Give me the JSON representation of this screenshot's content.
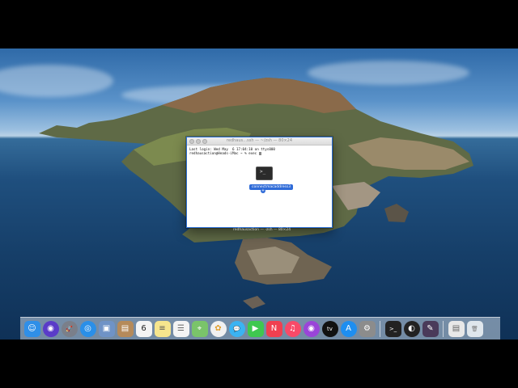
{
  "terminal": {
    "title": "redhaus…ssh — ~/zsh — 80×24",
    "lines": [
      "Last login: Wed May  6 17:04:10 on ttys000",
      "redhausaction@Heads-iMac ~ % exec "
    ]
  },
  "drag": {
    "icon_symbol": ">_",
    "label": "connectmacaddress3",
    "plus": "+"
  },
  "window_shadow_title": "redhausaction — -zsh — 80×24",
  "dock": {
    "items": [
      {
        "name": "finder-icon",
        "symbol": "☺",
        "bg": "#2f8fe8"
      },
      {
        "name": "siri-icon",
        "symbol": "◉",
        "bg": "#5a3cc8"
      },
      {
        "name": "launchpad-icon",
        "symbol": "🚀",
        "bg": "#7a7f8a"
      },
      {
        "name": "safari-icon",
        "symbol": "◎",
        "bg": "#2a8fe8"
      },
      {
        "name": "preview-icon",
        "symbol": "▣",
        "bg": "#6f93c6"
      },
      {
        "name": "contacts-icon",
        "symbol": "▤",
        "bg": "#b58a5a"
      },
      {
        "name": "calendar-icon",
        "symbol": "6",
        "bg": "#f4f4f4",
        "fg": "#222"
      },
      {
        "name": "notes-icon",
        "symbol": "≡",
        "bg": "#f6e58d",
        "fg": "#555"
      },
      {
        "name": "reminders-icon",
        "symbol": "☰",
        "bg": "#f4f4f4",
        "fg": "#666"
      },
      {
        "name": "maps-icon",
        "symbol": "⌖",
        "bg": "#7ac46a"
      },
      {
        "name": "photos-icon",
        "symbol": "✿",
        "bg": "#f1f1f1",
        "fg": "#e0a030"
      },
      {
        "name": "messages-icon",
        "symbol": "💬",
        "bg": "#3bb3f2"
      },
      {
        "name": "facetime-icon",
        "symbol": "▶",
        "bg": "#3fc84f"
      },
      {
        "name": "news-icon",
        "symbol": "N",
        "bg": "#f04050"
      },
      {
        "name": "music-icon",
        "symbol": "♫",
        "bg": "#f84a68"
      },
      {
        "name": "podcasts-icon",
        "symbol": "◉",
        "bg": "#9a45d8"
      },
      {
        "name": "apple-tv-icon",
        "symbol": "tv",
        "bg": "#111"
      },
      {
        "name": "app-store-icon",
        "symbol": "A",
        "bg": "#1e8ef0"
      },
      {
        "name": "system-preferences-icon",
        "symbol": "⚙",
        "bg": "#8c8c8c"
      },
      {
        "name": "terminal-icon",
        "symbol": ">_",
        "bg": "#222"
      },
      {
        "name": "obs-icon",
        "symbol": "◐",
        "bg": "#222"
      },
      {
        "name": "script-editor-icon",
        "symbol": "✎",
        "bg": "#4a3a5a"
      },
      {
        "name": "downloads-icon",
        "symbol": "▤",
        "bg": "#e8e8e8",
        "fg": "#666"
      },
      {
        "name": "trash-icon",
        "symbol": "🗑",
        "bg": "#dfe6ec",
        "fg": "#777"
      }
    ]
  },
  "colors": {
    "window_border": "#2a6fd6",
    "selection": "#2f6bd8"
  }
}
